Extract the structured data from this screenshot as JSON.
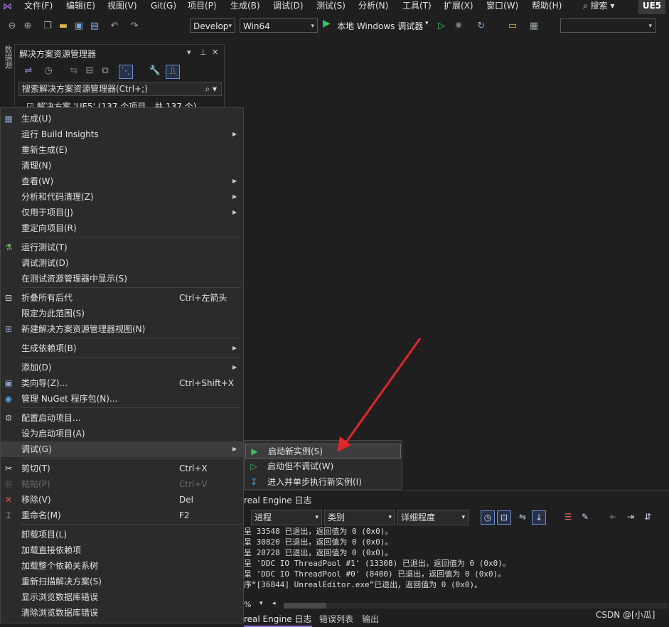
{
  "menubar": {
    "items": [
      "文件(F)",
      "编辑(E)",
      "视图(V)",
      "Git(G)",
      "项目(P)",
      "生成(B)",
      "调试(D)",
      "测试(S)",
      "分析(N)",
      "工具(T)",
      "扩展(X)",
      "窗口(W)",
      "帮助(H)"
    ],
    "search_label": "搜索",
    "project_badge": "UE5"
  },
  "toolbar": {
    "config": "Develop",
    "platform": "Win64",
    "run_label": "本地 Windows 调试器"
  },
  "left_strip": {
    "label": "数据源"
  },
  "solution_explorer": {
    "title": "解决方案资源管理器",
    "search_placeholder": "搜索解决方案资源管理器(Ctrl+;)",
    "root_node": "解决方案 'UE5' (137 个项目，共 137 个)"
  },
  "context_menu": {
    "items": [
      {
        "icon": "build-icon",
        "label": "生成(U)",
        "shortcut": "",
        "submenu": false
      },
      {
        "icon": "",
        "label": "运行 Build Insights",
        "shortcut": "",
        "submenu": true
      },
      {
        "icon": "",
        "label": "重新生成(E)",
        "shortcut": "",
        "submenu": false
      },
      {
        "icon": "",
        "label": "清理(N)",
        "shortcut": "",
        "submenu": false
      },
      {
        "icon": "",
        "label": "查看(W)",
        "shortcut": "",
        "submenu": true
      },
      {
        "icon": "",
        "label": "分析和代码清理(Z)",
        "shortcut": "",
        "submenu": true
      },
      {
        "icon": "",
        "label": "仅用于项目(J)",
        "shortcut": "",
        "submenu": true
      },
      {
        "icon": "",
        "label": "重定向项目(R)",
        "shortcut": "",
        "submenu": false
      },
      {
        "icon": "flask-icon",
        "label": "运行测试(T)",
        "shortcut": "",
        "submenu": false
      },
      {
        "icon": "",
        "label": "调试测试(D)",
        "shortcut": "",
        "submenu": false
      },
      {
        "icon": "",
        "label": "在测试资源管理器中显示(S)",
        "shortcut": "",
        "submenu": false
      },
      {
        "icon": "collapse-icon",
        "label": "折叠所有后代",
        "shortcut": "Ctrl+左箭头",
        "submenu": false
      },
      {
        "icon": "",
        "label": "限定为此范围(S)",
        "shortcut": "",
        "submenu": false
      },
      {
        "icon": "new-view-icon",
        "label": "新建解决方案资源管理器视图(N)",
        "shortcut": "",
        "submenu": false
      },
      {
        "icon": "",
        "label": "生成依赖项(B)",
        "shortcut": "",
        "submenu": true
      },
      {
        "icon": "",
        "label": "添加(D)",
        "shortcut": "",
        "submenu": true
      },
      {
        "icon": "class-wizard-icon",
        "label": "类向导(Z)...",
        "shortcut": "Ctrl+Shift+X",
        "submenu": false
      },
      {
        "icon": "nuget-icon",
        "label": "管理 NuGet 程序包(N)...",
        "shortcut": "",
        "submenu": false
      },
      {
        "icon": "gear-icon",
        "label": "配置启动项目...",
        "shortcut": "",
        "submenu": false
      },
      {
        "icon": "",
        "label": "设为启动项目(A)",
        "shortcut": "",
        "submenu": false
      },
      {
        "icon": "",
        "label": "调试(G)",
        "shortcut": "",
        "submenu": true
      },
      {
        "icon": "scissors-icon",
        "label": "剪切(T)",
        "shortcut": "Ctrl+X",
        "submenu": false
      },
      {
        "icon": "paste-icon",
        "label": "粘贴(P)",
        "shortcut": "Ctrl+V",
        "submenu": false
      },
      {
        "icon": "remove-icon",
        "label": "移除(V)",
        "shortcut": "Del",
        "submenu": false
      },
      {
        "icon": "rename-icon",
        "label": "重命名(M)",
        "shortcut": "F2",
        "submenu": false
      },
      {
        "icon": "",
        "label": "卸载项目(L)",
        "shortcut": "",
        "submenu": false
      },
      {
        "icon": "",
        "label": "加载直接依赖项",
        "shortcut": "",
        "submenu": false
      },
      {
        "icon": "",
        "label": "加载整个依赖关系树",
        "shortcut": "",
        "submenu": false
      },
      {
        "icon": "",
        "label": "重新扫描解决方案(S)",
        "shortcut": "",
        "submenu": false
      },
      {
        "icon": "",
        "label": "显示浏览数据库错误",
        "shortcut": "",
        "submenu": false
      },
      {
        "icon": "",
        "label": "清除浏览数据库错误",
        "shortcut": "",
        "submenu": false
      }
    ]
  },
  "debug_submenu": {
    "items": [
      {
        "icon": "play-icon",
        "label": "启动新实例(S)"
      },
      {
        "icon": "play-outline-icon",
        "label": "启动但不调试(W)"
      },
      {
        "icon": "step-into-icon",
        "label": "进入并单步执行新实例(I)"
      }
    ]
  },
  "output_panel": {
    "title": "real Engine 日志",
    "filters": [
      "进程",
      "类别",
      "详细程度"
    ],
    "lines": [
      "呈 33548 已退出，返回值为 0 (0x0)。",
      "呈 30820 已退出，返回值为 0 (0x0)。",
      "呈 20728 已退出，返回值为 0 (0x0)。",
      "呈 'DDC IO ThreadPool #1' (13308) 已退出，返回值为 0 (0x0)。",
      "呈 'DDC IO ThreadPool #0' (8400) 已退出，返回值为 0 (0x0)。",
      "序“[36844] UnrealEditor.exe”已退出，返回值为 0 (0x0)。"
    ],
    "zoom": "% ",
    "tabs": [
      "real Engine 日志",
      "错误列表",
      "输出"
    ]
  },
  "watermark": "CSDN @[小瓜]",
  "colors": {
    "accent": "#8c6ee0",
    "arrow": "#e0262b",
    "play": "#3fbf5f"
  }
}
